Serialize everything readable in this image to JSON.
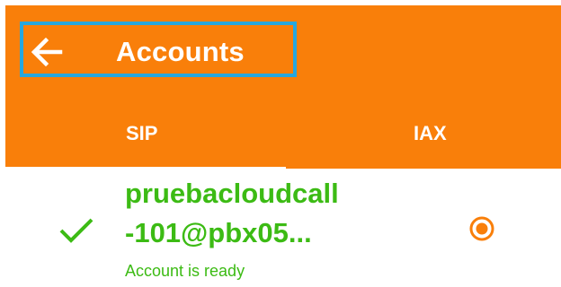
{
  "header": {
    "title": "Accounts",
    "back_icon": "arrow-left-icon",
    "background_color": "#f97f0a",
    "highlight_color": "#27a7de"
  },
  "tabs": [
    {
      "label": "SIP",
      "selected": true
    },
    {
      "label": "IAX",
      "selected": false
    }
  ],
  "accounts": [
    {
      "name": "pruebacloudcall\n-101@pbx05...",
      "status": "Account is ready",
      "status_icon": "checkmark-icon",
      "radio_selected": true,
      "status_color": "#3cbb14"
    }
  ]
}
